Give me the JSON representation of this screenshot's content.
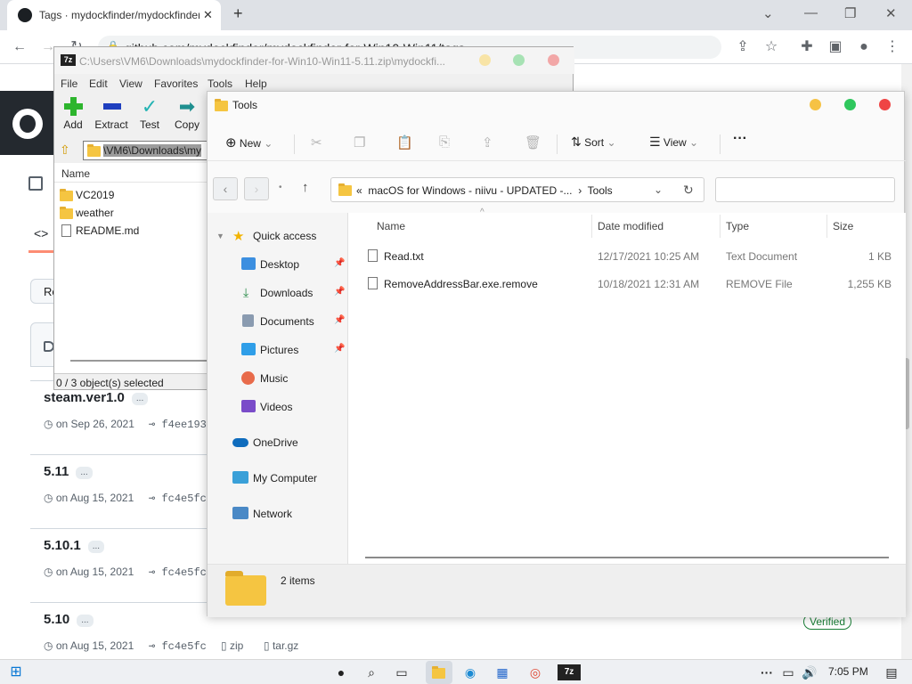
{
  "chrome": {
    "tab_title": "Tags · mydockfinder/mydockfinder",
    "url": "github.com/mydockfinder/mydockfinder-for-Win10-Win11/tags"
  },
  "github": {
    "tags": [
      {
        "name": "steam.ver1.0",
        "date": "on Sep 26, 2021",
        "commit": "f4ee193"
      },
      {
        "name": "5.11",
        "date": "on Aug 15, 2021",
        "commit": "fc4e5fc"
      },
      {
        "name": "5.10.1",
        "date": "on Aug 15, 2021",
        "commit": "fc4e5fc"
      },
      {
        "name": "5.10",
        "date": "on Aug 15, 2021",
        "commit": "fc4e5fc"
      }
    ],
    "ellipsis": "...",
    "zip_label": "zip",
    "targz_label": "tar.gz",
    "verified_label": "Verified",
    "releases_btn": "Re"
  },
  "sevenzip": {
    "title": "C:\\Users\\VM6\\Downloads\\mydockfinder-for-Win10-Win11-5.11.zip\\mydockfi...",
    "logo": "7z",
    "menu": [
      "File",
      "Edit",
      "View",
      "Favorites",
      "Tools",
      "Help"
    ],
    "toolbar": {
      "add": "Add",
      "extract": "Extract",
      "test": "Test",
      "copy": "Copy"
    },
    "address": "\\VM6\\Downloads\\my",
    "list_header": "Name",
    "items": [
      {
        "name": "VC2019",
        "kind": "folder"
      },
      {
        "name": "weather",
        "kind": "folder"
      },
      {
        "name": "README.md",
        "kind": "file"
      }
    ],
    "status": "0 / 3 object(s) selected"
  },
  "explorer": {
    "title": "Tools",
    "commands": {
      "new": "New",
      "sort": "Sort",
      "view": "View",
      "more": "···"
    },
    "breadcrumb": {
      "prefix": "«",
      "parent": "macOS for Windows - niivu - UPDATED -...",
      "sep": "›",
      "current": "Tools"
    },
    "search_placeholder": "",
    "nav": {
      "quick_access": "Quick access",
      "desktop": "Desktop",
      "downloads": "Downloads",
      "documents": "Documents",
      "pictures": "Pictures",
      "music": "Music",
      "videos": "Videos",
      "onedrive": "OneDrive",
      "mycomputer": "My Computer",
      "network": "Network"
    },
    "columns": {
      "name": "Name",
      "date": "Date modified",
      "type": "Type",
      "size": "Size"
    },
    "files": [
      {
        "name": "Read.txt",
        "date": "12/17/2021 10:25 AM",
        "type": "Text Document",
        "size": "1 KB"
      },
      {
        "name": "RemoveAddressBar.exe.remove",
        "date": "10/18/2021 12:31 AM",
        "type": "REMOVE File",
        "size": "1,255 KB"
      }
    ],
    "item_count": "2 items"
  },
  "taskbar": {
    "time": "7:05 PM",
    "overflow": "···"
  },
  "colors": {
    "mac_yellow": "#f6c244",
    "mac_green": "#2fc75d",
    "mac_red": "#ef4444",
    "github_dark": "#24292f",
    "folder": "#f5c541"
  }
}
